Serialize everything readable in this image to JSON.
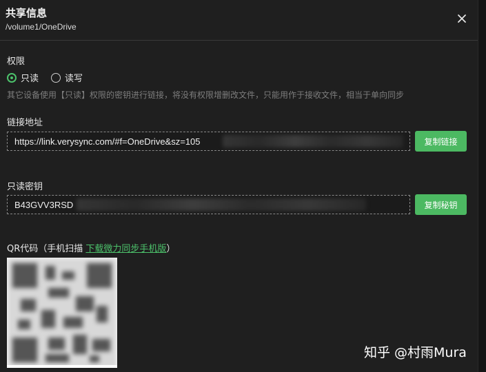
{
  "dialog": {
    "title": "共享信息",
    "path": "/volume1/OneDrive",
    "close_icon": "close-icon"
  },
  "permission": {
    "label": "权限",
    "options": [
      {
        "label": "只读",
        "selected": true
      },
      {
        "label": "读写",
        "selected": false
      }
    ],
    "hint": "其它设备使用【只读】权限的密钥进行链接，将没有权限增删改文件，只能用作于接收文件，相当于单向同步"
  },
  "link": {
    "label": "链接地址",
    "value": "https://link.verysync.com/#f=OneDrive&sz=105",
    "button": "复制链接"
  },
  "key": {
    "label": "只读密钥",
    "value": "B43GVV3RSD",
    "button": "复制秘钥"
  },
  "qr": {
    "label_prefix": "QR代码（手机扫描 ",
    "link_text": "下载微力同步手机版",
    "label_suffix": "）"
  },
  "watermark": "知乎 @村雨Mura",
  "colors": {
    "accent": "#4cb962",
    "background": "#1f1f1f"
  }
}
